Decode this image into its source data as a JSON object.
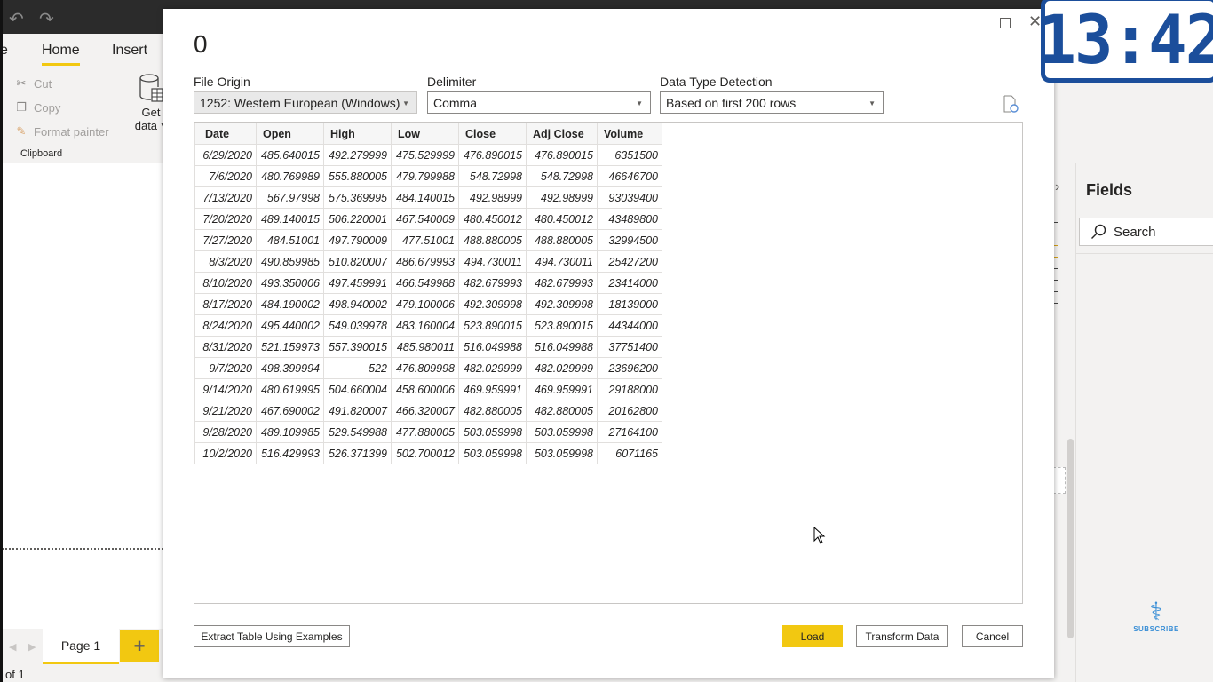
{
  "app": {
    "ribbon_tabs": [
      {
        "label": "e"
      },
      {
        "label": "Home"
      },
      {
        "label": "Insert"
      }
    ],
    "clipboard": {
      "items": [
        {
          "label": "Cut",
          "icon": "scissors-icon"
        },
        {
          "label": "Copy",
          "icon": "copy-icon"
        },
        {
          "label": "Format painter",
          "icon": "format-painter-icon"
        }
      ],
      "group_label": "Clipboard"
    },
    "get_data": {
      "line1": "Get",
      "line2": "data ˅"
    },
    "pages": {
      "tab_label": "Page 1",
      "add_label": "+",
      "count_text": "of 1"
    },
    "fields_pane": {
      "title": "Fields",
      "search_placeholder": "Search"
    },
    "subscribe": {
      "label": "SUBSCRIBE"
    },
    "clock": "13:42"
  },
  "dialog": {
    "title": "0",
    "file_origin": {
      "label": "File Origin",
      "value": "1252: Western European (Windows)"
    },
    "delimiter": {
      "label": "Delimiter",
      "value": "Comma"
    },
    "data_type_detection": {
      "label": "Data Type Detection",
      "value": "Based on first 200 rows"
    },
    "table": {
      "columns": [
        "Date",
        "Open",
        "High",
        "Low",
        "Close",
        "Adj Close",
        "Volume"
      ],
      "rows": [
        [
          "6/29/2020",
          "485.640015",
          "492.279999",
          "475.529999",
          "476.890015",
          "476.890015",
          "6351500"
        ],
        [
          "7/6/2020",
          "480.769989",
          "555.880005",
          "479.799988",
          "548.72998",
          "548.72998",
          "46646700"
        ],
        [
          "7/13/2020",
          "567.97998",
          "575.369995",
          "484.140015",
          "492.98999",
          "492.98999",
          "93039400"
        ],
        [
          "7/20/2020",
          "489.140015",
          "506.220001",
          "467.540009",
          "480.450012",
          "480.450012",
          "43489800"
        ],
        [
          "7/27/2020",
          "484.51001",
          "497.790009",
          "477.51001",
          "488.880005",
          "488.880005",
          "32994500"
        ],
        [
          "8/3/2020",
          "490.859985",
          "510.820007",
          "486.679993",
          "494.730011",
          "494.730011",
          "25427200"
        ],
        [
          "8/10/2020",
          "493.350006",
          "497.459991",
          "466.549988",
          "482.679993",
          "482.679993",
          "23414000"
        ],
        [
          "8/17/2020",
          "484.190002",
          "498.940002",
          "479.100006",
          "492.309998",
          "492.309998",
          "18139000"
        ],
        [
          "8/24/2020",
          "495.440002",
          "549.039978",
          "483.160004",
          "523.890015",
          "523.890015",
          "44344000"
        ],
        [
          "8/31/2020",
          "521.159973",
          "557.390015",
          "485.980011",
          "516.049988",
          "516.049988",
          "37751400"
        ],
        [
          "9/7/2020",
          "498.399994",
          "522",
          "476.809998",
          "482.029999",
          "482.029999",
          "23696200"
        ],
        [
          "9/14/2020",
          "480.619995",
          "504.660004",
          "458.600006",
          "469.959991",
          "469.959991",
          "29188000"
        ],
        [
          "9/21/2020",
          "467.690002",
          "491.820007",
          "466.320007",
          "482.880005",
          "482.880005",
          "20162800"
        ],
        [
          "9/28/2020",
          "489.109985",
          "529.549988",
          "477.880005",
          "503.059998",
          "503.059998",
          "27164100"
        ],
        [
          "10/2/2020",
          "516.429993",
          "526.371399",
          "502.700012",
          "503.059998",
          "503.059998",
          "6071165"
        ]
      ]
    },
    "buttons": {
      "extract": "Extract Table Using Examples",
      "load": "Load",
      "transform": "Transform Data",
      "cancel": "Cancel"
    }
  },
  "colors": {
    "accent": "#f2c811",
    "clock_blue": "#1b4e9b",
    "subscribe_blue": "#3a8fd6"
  }
}
